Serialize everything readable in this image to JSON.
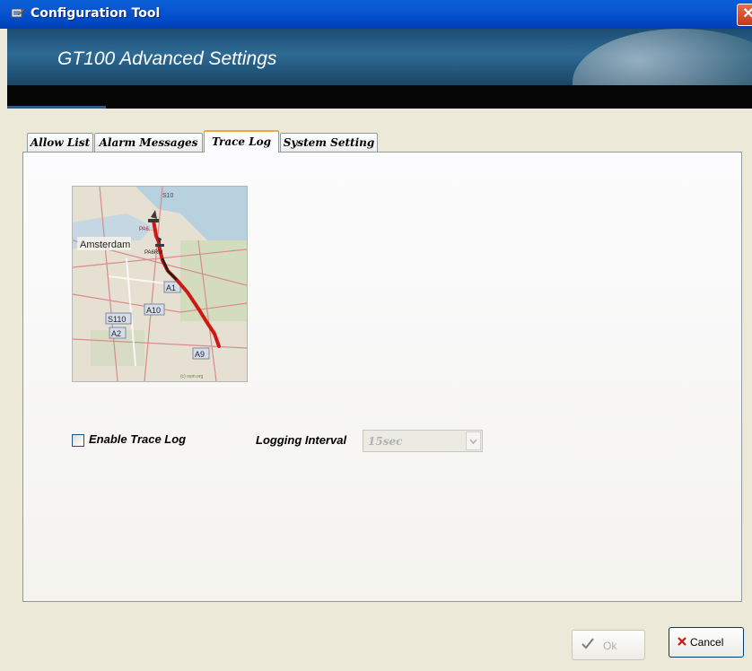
{
  "window": {
    "title": "Configuration Tool",
    "close_glyph": "✕"
  },
  "banner": {
    "title": "GT100 Advanced Settings"
  },
  "tabs": [
    {
      "label": "Allow List",
      "active": false
    },
    {
      "label": "Alarm Messages",
      "active": false
    },
    {
      "label": "Trace Log",
      "active": true
    },
    {
      "label": "System Setting",
      "active": false
    }
  ],
  "trace_log": {
    "map": {
      "city_label": "Amsterdam",
      "road_labels": [
        "S10",
        "A1",
        "A10",
        "S110",
        "A2",
        "A9"
      ],
      "markers": [
        "PA6....",
        "PA6RM"
      ],
      "copyright": "(c) osm.org"
    },
    "enable_label": "Enable Trace Log",
    "enable_checked": false,
    "interval_label": "Logging Interval",
    "interval_value": "15sec"
  },
  "buttons": {
    "ok_label": "Ok",
    "cancel_label": "Cancel"
  },
  "colors": {
    "title_bar": "#0a56d0",
    "banner": "#2d6a94",
    "route": "#cc1a12",
    "active_tab_accent": "#f2a73c"
  }
}
